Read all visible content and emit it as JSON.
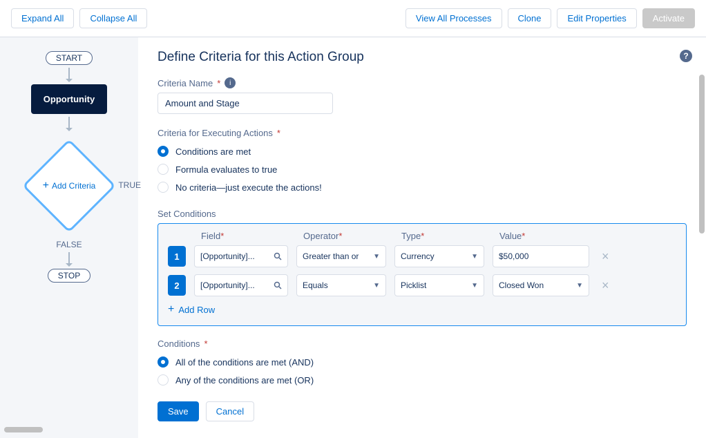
{
  "toolbar": {
    "expand_all": "Expand All",
    "collapse_all": "Collapse All",
    "view_all": "View All Processes",
    "clone": "Clone",
    "edit_props": "Edit Properties",
    "activate": "Activate"
  },
  "canvas": {
    "start": "START",
    "object": "Opportunity",
    "add_criteria": "Add Criteria",
    "true_label": "TRUE",
    "false_label": "FALSE",
    "stop": "STOP"
  },
  "panel": {
    "title": "Define Criteria for this Action Group",
    "criteria_name_label": "Criteria Name",
    "criteria_name_value": "Amount and Stage",
    "exec_label": "Criteria for Executing Actions",
    "exec_options": {
      "opt1": "Conditions are met",
      "opt2": "Formula evaluates to true",
      "opt3": "No criteria—just execute the actions!"
    },
    "set_conditions_label": "Set Conditions",
    "headers": {
      "field": "Field",
      "operator": "Operator",
      "type": "Type",
      "value": "Value"
    },
    "rows": [
      {
        "num": "1",
        "field": "[Opportunity]...",
        "operator": "Greater than or",
        "type": "Currency",
        "value": "$50,000"
      },
      {
        "num": "2",
        "field": "[Opportunity]...",
        "operator": "Equals",
        "type": "Picklist",
        "value": "Closed Won"
      }
    ],
    "add_row": "Add Row",
    "conditions_label": "Conditions",
    "cond_options": {
      "and": "All of the conditions are met (AND)",
      "or": "Any of the conditions are met (OR)"
    },
    "save": "Save",
    "cancel": "Cancel"
  }
}
